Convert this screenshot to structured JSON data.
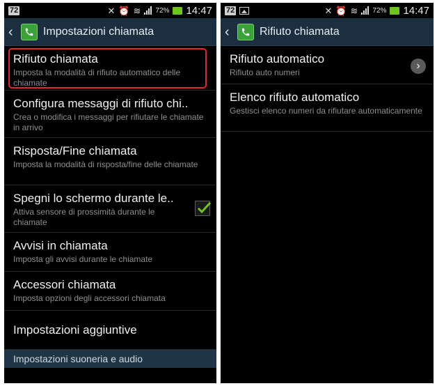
{
  "status_bar": {
    "badge": "72",
    "battery_pct": "72%",
    "time": "14:47"
  },
  "left": {
    "title": "Impostazioni chiamata",
    "items": [
      {
        "title": "Rifiuto chiamata",
        "subtitle": "Imposta la modalità di rifiuto automatico delle chiamate",
        "highlighted": true
      },
      {
        "title": "Configura messaggi di rifiuto chi..",
        "subtitle": "Crea o modifica i messaggi per rifiutare le chiamate in arrivo"
      },
      {
        "title": "Risposta/Fine chiamata",
        "subtitle": "Imposta la modalità di risposta/fine delle chiamate"
      },
      {
        "title": "Spegni lo schermo durante le..",
        "subtitle": "Attiva sensore di prossimità durante le chiamate",
        "checked": true
      },
      {
        "title": "Avvisi in chiamata",
        "subtitle": "Imposta gli avvisi durante le chiamate"
      },
      {
        "title": "Accessori chiamata",
        "subtitle": "Imposta opzioni degli accessori chiamata"
      },
      {
        "title": "Impostazioni aggiuntive"
      }
    ],
    "section_header": "Impostazioni suoneria e audio"
  },
  "right": {
    "title": "Rifiuto chiamata",
    "items": [
      {
        "title": "Rifiuto automatico",
        "subtitle": "Rifiuto auto numeri"
      },
      {
        "title": "Elenco rifiuto automatico",
        "subtitle": "Gestisci elenco numeri da rifiutare automaticamente"
      }
    ]
  },
  "colors": {
    "accent_green": "#6ec61a",
    "action_bar": "#1b2f40",
    "highlight": "#e2262b"
  }
}
